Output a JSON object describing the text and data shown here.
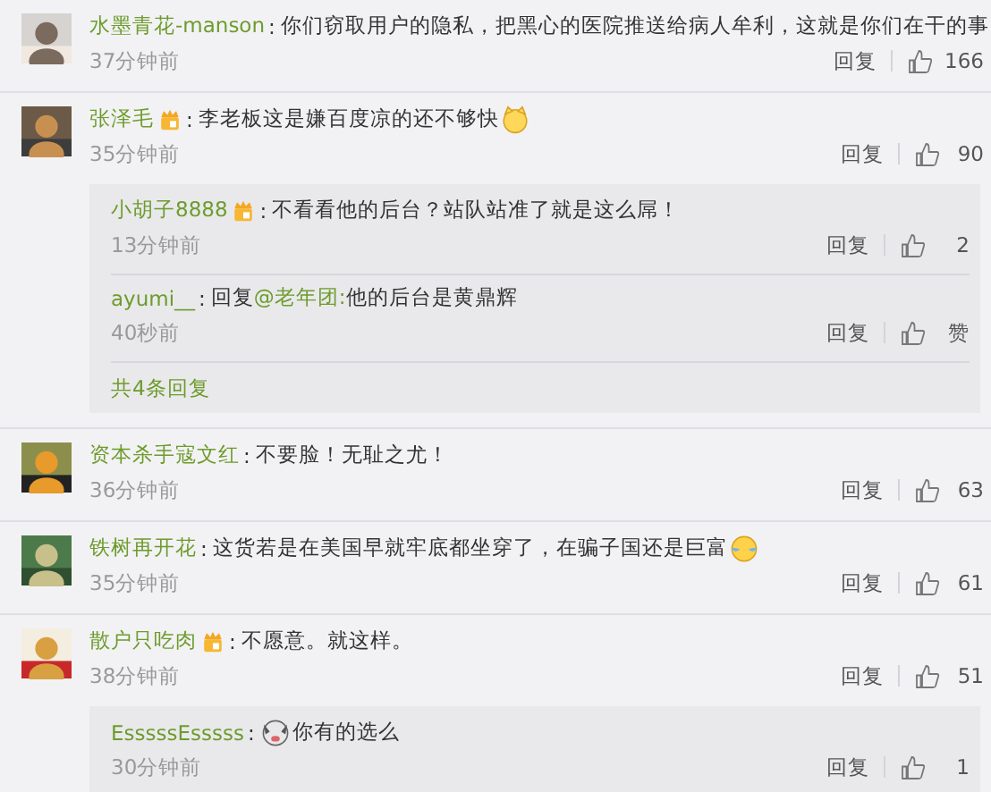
{
  "comments": [
    {
      "avatar": {
        "kind": "picture"
      },
      "name": "水墨青花-manson",
      "badge": false,
      "colon": ":",
      "text": "你们窃取用户的隐私，把黑心的医院推送给病人牟利，这就是你们在干的事",
      "time": "37分钟前",
      "reply": "回复",
      "likes": "166"
    },
    {
      "avatar": {
        "kind": "picture"
      },
      "name": "张泽毛",
      "badge": true,
      "colon": ":",
      "text": "李老板这是嫌百度凉的还不够快",
      "emoji_after": {
        "kind": "cat"
      },
      "time": "35分钟前",
      "reply": "回复",
      "likes": "90",
      "replies": [
        {
          "name": "小胡子8888",
          "badge": true,
          "colon": ":",
          "text": "不看看他的后台？站队站准了就是这么屌！",
          "time": "13分钟前",
          "reply": "回复",
          "likes": "2"
        },
        {
          "name": "ayumi__",
          "badge": false,
          "colon": ":",
          "text_prefix": "回复",
          "mention": "@老年团:",
          "text": "他的后台是黄鼎辉",
          "time": "40秒前",
          "reply": "回复",
          "likes": "赞"
        }
      ],
      "more": "共4条回复"
    },
    {
      "avatar": {
        "kind": "picture"
      },
      "name": "资本杀手寇文红",
      "badge": false,
      "colon": ":",
      "text": "不要脸！无耻之尤！",
      "time": "36分钟前",
      "reply": "回复",
      "likes": "63"
    },
    {
      "avatar": {
        "kind": "picture"
      },
      "name": "铁树再开花",
      "badge": false,
      "colon": ":",
      "text": "这货若是在美国早就牢底都坐穿了，在骗子国还是巨富",
      "emoji_after": {
        "kind": "laugh"
      },
      "time": "35分钟前",
      "reply": "回复",
      "likes": "61"
    },
    {
      "avatar": {
        "kind": "picture"
      },
      "name": "散户只吃肉",
      "badge": true,
      "colon": ":",
      "text": "不愿意。就这样。",
      "time": "38分钟前",
      "reply": "回复",
      "likes": "51",
      "replies": [
        {
          "name": "EsssssEsssss",
          "badge": false,
          "colon": ":",
          "emoji_before": {
            "kind": "dog"
          },
          "text": "你有的选么",
          "time": "30分钟前",
          "reply": "回复",
          "likes": "1"
        }
      ]
    }
  ]
}
